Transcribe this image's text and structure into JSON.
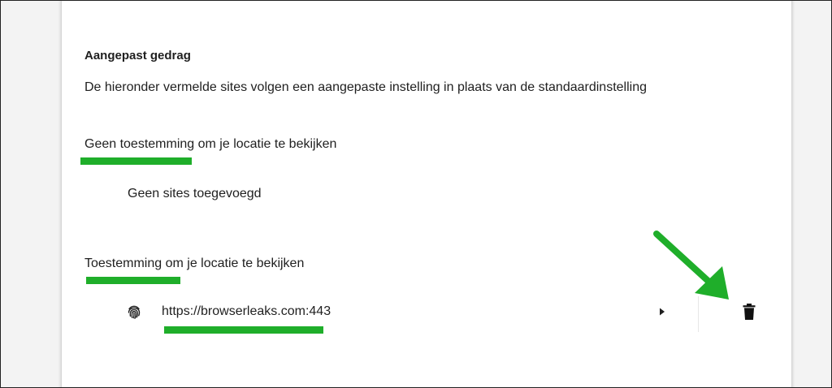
{
  "section": {
    "heading": "Aangepast gedrag",
    "description": "De hieronder vermelde sites volgen een aangepaste instelling in plaats van de standaardinstelling"
  },
  "blocked": {
    "title": "Geen toestemming om je locatie te bekijken",
    "empty_text": "Geen sites toegevoegd"
  },
  "allowed": {
    "title": "Toestemming om je locatie te bekijken",
    "sites": [
      {
        "url": "https://browserleaks.com:443",
        "icon": "fingerprint-icon"
      }
    ]
  },
  "icons": {
    "expand": "triangle-right-icon",
    "delete": "trash-icon"
  },
  "colors": {
    "highlight": "#1fae2a",
    "arrow": "#1fae2a",
    "text": "#1f1f1f",
    "background": "#f3f3f3",
    "card": "#ffffff"
  }
}
